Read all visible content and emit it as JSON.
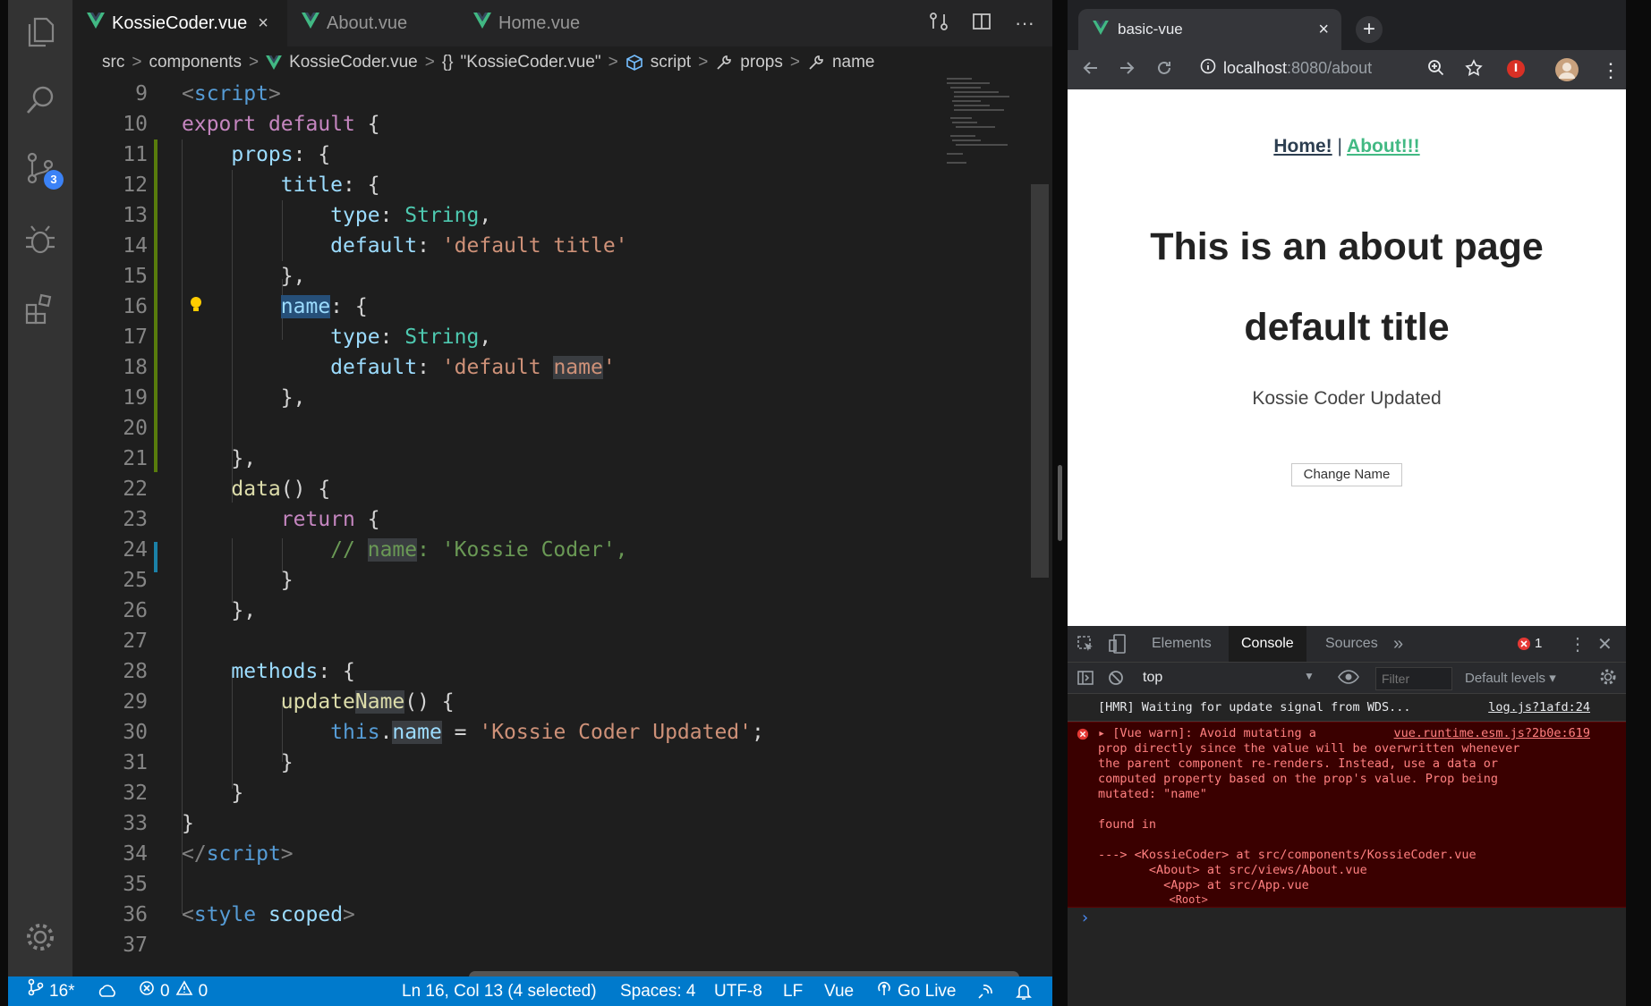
{
  "editor": {
    "tabs": [
      {
        "label": "KossieCoder.vue",
        "active": true
      },
      {
        "label": "About.vue",
        "active": false
      },
      {
        "label": "Home.vue",
        "active": false
      }
    ],
    "tab_close": "×",
    "breadcrumbs": {
      "src": "src",
      "components": "components",
      "file": "KossieCoder.vue",
      "obj": "\"KossieCoder.vue\"",
      "obj_brace": "{}",
      "script": "script",
      "props": "props",
      "name": "name",
      "sep": ">"
    },
    "lines": [
      {
        "n": "9"
      },
      {
        "n": "10"
      },
      {
        "n": "11"
      },
      {
        "n": "12"
      },
      {
        "n": "13"
      },
      {
        "n": "14"
      },
      {
        "n": "15"
      },
      {
        "n": "16"
      },
      {
        "n": "17"
      },
      {
        "n": "18"
      },
      {
        "n": "19"
      },
      {
        "n": "20"
      },
      {
        "n": "21"
      },
      {
        "n": "22"
      },
      {
        "n": "23"
      },
      {
        "n": "24"
      },
      {
        "n": "25"
      },
      {
        "n": "26"
      },
      {
        "n": "27"
      },
      {
        "n": "28"
      },
      {
        "n": "29"
      },
      {
        "n": "30"
      },
      {
        "n": "31"
      },
      {
        "n": "32"
      },
      {
        "n": "33"
      },
      {
        "n": "34"
      },
      {
        "n": "35"
      },
      {
        "n": "36"
      },
      {
        "n": "37"
      }
    ],
    "code": {
      "l9": {
        "lt": "<",
        "tag": "script",
        "gt": ">"
      },
      "l10": {
        "kw1": "export",
        "kw2": "default",
        "brace": " {"
      },
      "l11": {
        "key": "props",
        "rest": ": {"
      },
      "l12": {
        "key": "title",
        "rest": ": {"
      },
      "l13": {
        "key": "type",
        "colon": ": ",
        "val": "String",
        "comma": ","
      },
      "l14": {
        "key": "default",
        "colon": ": ",
        "val": "'default title'"
      },
      "l15": {
        "text": "},"
      },
      "l16": {
        "sel": "name",
        "rest": ": {"
      },
      "l17": {
        "key": "type",
        "colon": ": ",
        "val": "String",
        "comma": ","
      },
      "l18": {
        "key": "default",
        "colon": ": ",
        "val1": "'default ",
        "val2": "name",
        "val3": "'"
      },
      "l19": {
        "text": "},"
      },
      "l21": {
        "text": "},"
      },
      "l22": {
        "fn": "data",
        "rest": "() {"
      },
      "l23": {
        "kw": "return",
        "rest": " {"
      },
      "l24": {
        "c1": "// ",
        "c2": "name",
        "c3": ": 'Kossie Coder',"
      },
      "l25": {
        "text": "}"
      },
      "l26": {
        "text": "},"
      },
      "l28": {
        "key": "methods",
        "rest": ": {"
      },
      "l29": {
        "fn1": "update",
        "fn2": "Name",
        "rest": "() {"
      },
      "l30": {
        "this": "this",
        "dot": ".",
        "prop": "name",
        "eq": " = ",
        "val": "'Kossie Coder Updated'",
        "semi": ";"
      },
      "l31": {
        "text": "}"
      },
      "l32": {
        "text": "}"
      },
      "l33": {
        "text": "}"
      },
      "l34": {
        "lt": "</",
        "tag": "script",
        "gt": ">"
      },
      "l36": {
        "lt": "<",
        "tag": "style",
        "attr": " scoped",
        "gt": ">"
      }
    }
  },
  "activity_bar": {
    "badge": "3",
    "icons": [
      "files-icon",
      "search-icon",
      "source-control-icon",
      "debug-icon",
      "extensions-icon",
      "settings-gear-icon"
    ]
  },
  "status_bar": {
    "branch": "16*",
    "errors": "0",
    "warnings": "0",
    "position": "Ln 16, Col 13 (4 selected)",
    "spaces": "Spaces: 4",
    "encoding": "UTF-8",
    "eol": "LF",
    "language": "Vue",
    "go_live": "Go Live"
  },
  "browser": {
    "tab_title": "basic-vue",
    "tab_close": "×",
    "new_tab": "+",
    "url_host": "localhost",
    "url_rest": ":8080/about",
    "page": {
      "nav_home": "Home!",
      "nav_sep": "|",
      "nav_about": "About!!!",
      "heading1": "This is an about page",
      "heading2": "default title",
      "name_text": "Kossie Coder Updated",
      "button": "Change Name"
    },
    "devtools": {
      "tabs": [
        "Elements",
        "Console",
        "Sources"
      ],
      "more": "»",
      "error_count": "1",
      "context": "top",
      "filter_placeholder": "Filter",
      "levels": "Default levels ▾",
      "info_msg": "[HMR] Waiting for update signal from WDS...",
      "info_link": "log.js?1afd:24",
      "err_link": "vue.runtime.esm.js?2b0e:619",
      "err_lines": [
        "▸ [Vue warn]: Avoid mutating a",
        "prop directly since the value will be overwritten whenever",
        "the parent component re-renders. Instead, use a data or",
        "computed property based on the prop's value. Prop being",
        "mutated: \"name\"",
        "",
        "found in",
        "",
        "---> <KossieCoder> at src/components/KossieCoder.vue",
        "       <About> at src/views/About.vue",
        "         <App> at src/App.vue",
        "           <Root>"
      ],
      "prompt": "›"
    }
  }
}
